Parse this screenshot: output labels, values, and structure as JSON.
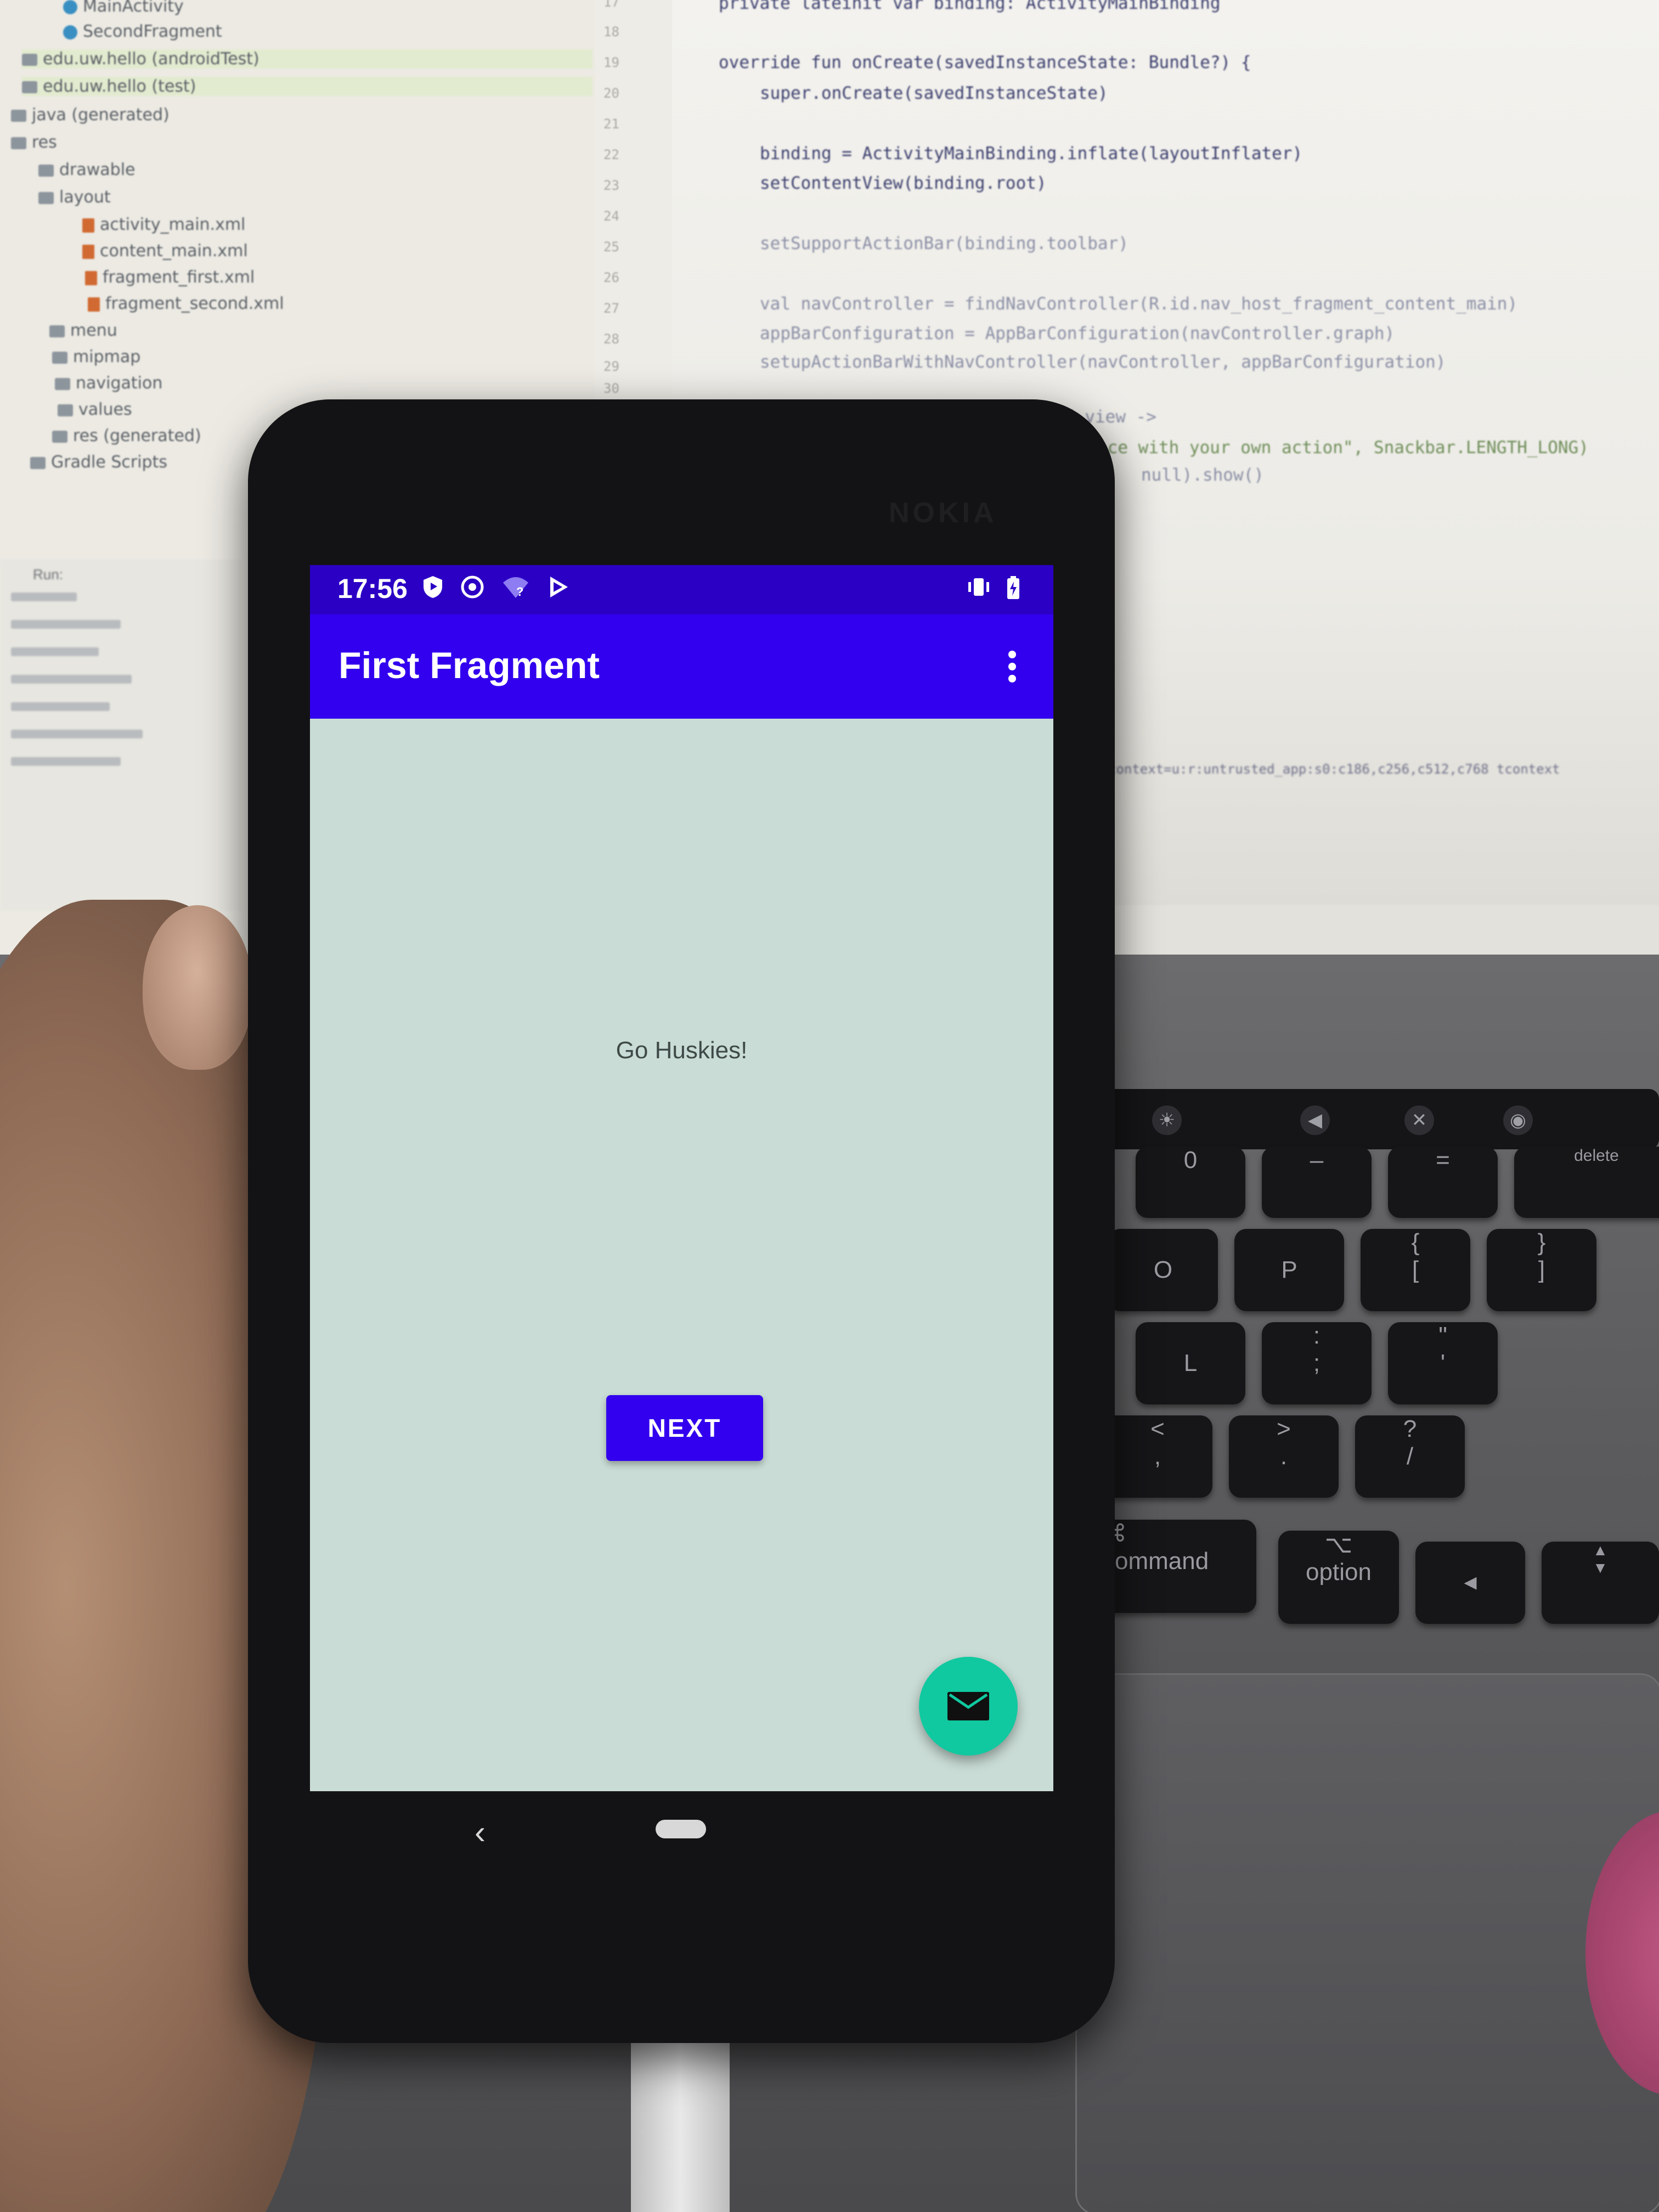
{
  "ide": {
    "project_tree": [
      "MainActivity",
      "SecondFragment",
      "edu.uw.hello (androidTest)",
      "edu.uw.hello (test)",
      "java (generated)",
      "res",
      "drawable",
      "layout",
      "activity_main.xml",
      "content_main.xml",
      "fragment_first.xml",
      "fragment_second.xml",
      "menu",
      "mipmap",
      "navigation",
      "values",
      "res (generated)",
      "Gradle Scripts"
    ],
    "line_numbers": [
      "17",
      "18",
      "19",
      "20",
      "21",
      "22",
      "23",
      "24",
      "25",
      "26",
      "27",
      "28",
      "29",
      "30"
    ],
    "code_lines": [
      "private lateinit var binding: ActivityMainBinding",
      "override fun onCreate(savedInstanceState: Bundle?) {",
      "super.onCreate(savedInstanceState)",
      "binding = ActivityMainBinding.inflate(layoutInflater)",
      "setContentView(binding.root)",
      "setSupportActionBar(binding.toolbar)",
      "val navController = findNavController(R.id.nav_host_fragment_content_main)",
      "appBarConfiguration = AppBarConfiguration(navController.graph)",
      "setupActionBarWithNavController(navController, appBarConfiguration)",
      "{ view ->",
      "ace with your own action\", Snackbar.LENGTH_LONG)",
      "null).show()"
    ],
    "log_text": "context=u:r:untrusted_app:s0:c186,c256,c512,c768 tcontext",
    "run_panel_title": "Run:"
  },
  "phone": {
    "brand": "NOKIA",
    "status_bar": {
      "time": "17:56",
      "icons": [
        "shield-play-icon",
        "do-not-disturb-icon",
        "wifi-unknown-icon",
        "play-store-icon",
        "vibrate-icon",
        "battery-icon"
      ]
    },
    "app_bar": {
      "title": "First Fragment",
      "overflow_icon": "more-vert-icon"
    },
    "content": {
      "text": "Go Huskies!",
      "next_button_label": "NEXT"
    },
    "fab_icon": "email-icon",
    "nav": {
      "back_glyph": "‹"
    }
  },
  "keyboard": {
    "keys": [
      {
        "top": "",
        "bottom": "0"
      },
      {
        "top": "",
        "bottom": "–"
      },
      {
        "top": "",
        "bottom": "="
      },
      {
        "top": "",
        "bottom": "delete"
      },
      {
        "top": "",
        "bottom": "O"
      },
      {
        "top": "",
        "bottom": "P"
      },
      {
        "top": "{",
        "bottom": "["
      },
      {
        "top": "}",
        "bottom": "]"
      },
      {
        "top": "",
        "bottom": "L"
      },
      {
        "top": ":",
        "bottom": ";"
      },
      {
        "top": "\"",
        "bottom": "'"
      },
      {
        "top": "<",
        "bottom": ","
      },
      {
        "top": ">",
        "bottom": "."
      },
      {
        "top": "?",
        "bottom": "/"
      },
      {
        "top": "⌘",
        "bottom": "command"
      },
      {
        "top": "⌥",
        "bottom": "option"
      },
      {
        "top": "",
        "bottom": "◀"
      },
      {
        "top": "▲",
        "bottom": "▼"
      }
    ]
  },
  "colors": {
    "status_bar": "#2b00c4",
    "app_bar": "#3200ee",
    "screen_bg": "#c9dcd5",
    "fab": "#10c9a0"
  }
}
